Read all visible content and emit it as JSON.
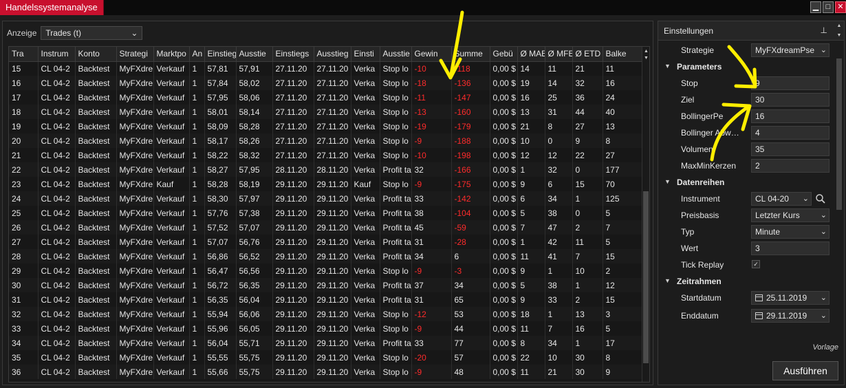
{
  "window": {
    "title": "Handelssystemanalyse"
  },
  "toolbar": {
    "label": "Anzeige",
    "view_selected": "Trades (t)"
  },
  "grid": {
    "columns": [
      "Tra",
      "Instrum",
      "Konto",
      "Strategi",
      "Marktpo",
      "An",
      "Einstieg",
      "Ausstie",
      "Einstiegs",
      "Ausstieg",
      "Einsti",
      "Ausstie",
      "Gewin",
      "Summe",
      "Gebü",
      "Ø MAE",
      "Ø MFE",
      "Ø ETD",
      "Balke"
    ],
    "rows": [
      [
        "15",
        "CL 04-2",
        "Backtest",
        "MyFXdre",
        "Verkauf",
        "1",
        "57,81",
        "57,91",
        "27.11.20",
        "27.11.20",
        "Verka",
        "Stop lo",
        "-10",
        "-118",
        "0,00 $",
        "14",
        "11",
        "21",
        "11"
      ],
      [
        "16",
        "CL 04-2",
        "Backtest",
        "MyFXdre",
        "Verkauf",
        "1",
        "57,84",
        "58,02",
        "27.11.20",
        "27.11.20",
        "Verka",
        "Stop lo",
        "-18",
        "-136",
        "0,00 $",
        "19",
        "14",
        "32",
        "16"
      ],
      [
        "17",
        "CL 04-2",
        "Backtest",
        "MyFXdre",
        "Verkauf",
        "1",
        "57,95",
        "58,06",
        "27.11.20",
        "27.11.20",
        "Verka",
        "Stop lo",
        "-11",
        "-147",
        "0,00 $",
        "16",
        "25",
        "36",
        "24"
      ],
      [
        "18",
        "CL 04-2",
        "Backtest",
        "MyFXdre",
        "Verkauf",
        "1",
        "58,01",
        "58,14",
        "27.11.20",
        "27.11.20",
        "Verka",
        "Stop lo",
        "-13",
        "-160",
        "0,00 $",
        "13",
        "31",
        "44",
        "40"
      ],
      [
        "19",
        "CL 04-2",
        "Backtest",
        "MyFXdre",
        "Verkauf",
        "1",
        "58,09",
        "58,28",
        "27.11.20",
        "27.11.20",
        "Verka",
        "Stop lo",
        "-19",
        "-179",
        "0,00 $",
        "21",
        "8",
        "27",
        "13"
      ],
      [
        "20",
        "CL 04-2",
        "Backtest",
        "MyFXdre",
        "Verkauf",
        "1",
        "58,17",
        "58,26",
        "27.11.20",
        "27.11.20",
        "Verka",
        "Stop lo",
        "-9",
        "-188",
        "0,00 $",
        "10",
        "0",
        "9",
        "8"
      ],
      [
        "21",
        "CL 04-2",
        "Backtest",
        "MyFXdre",
        "Verkauf",
        "1",
        "58,22",
        "58,32",
        "27.11.20",
        "27.11.20",
        "Verka",
        "Stop lo",
        "-10",
        "-198",
        "0,00 $",
        "12",
        "12",
        "22",
        "27"
      ],
      [
        "22",
        "CL 04-2",
        "Backtest",
        "MyFXdre",
        "Verkauf",
        "1",
        "58,27",
        "57,95",
        "28.11.20",
        "28.11.20",
        "Verka",
        "Profit ta",
        "32",
        "-166",
        "0,00 $",
        "1",
        "32",
        "0",
        "177"
      ],
      [
        "23",
        "CL 04-2",
        "Backtest",
        "MyFXdre",
        "Kauf",
        "1",
        "58,28",
        "58,19",
        "29.11.20",
        "29.11.20",
        "Kauf",
        "Stop lo",
        "-9",
        "-175",
        "0,00 $",
        "9",
        "6",
        "15",
        "70"
      ],
      [
        "24",
        "CL 04-2",
        "Backtest",
        "MyFXdre",
        "Verkauf",
        "1",
        "58,30",
        "57,97",
        "29.11.20",
        "29.11.20",
        "Verka",
        "Profit ta",
        "33",
        "-142",
        "0,00 $",
        "6",
        "34",
        "1",
        "125"
      ],
      [
        "25",
        "CL 04-2",
        "Backtest",
        "MyFXdre",
        "Verkauf",
        "1",
        "57,76",
        "57,38",
        "29.11.20",
        "29.11.20",
        "Verka",
        "Profit ta",
        "38",
        "-104",
        "0,00 $",
        "5",
        "38",
        "0",
        "5"
      ],
      [
        "26",
        "CL 04-2",
        "Backtest",
        "MyFXdre",
        "Verkauf",
        "1",
        "57,52",
        "57,07",
        "29.11.20",
        "29.11.20",
        "Verka",
        "Profit ta",
        "45",
        "-59",
        "0,00 $",
        "7",
        "47",
        "2",
        "7"
      ],
      [
        "27",
        "CL 04-2",
        "Backtest",
        "MyFXdre",
        "Verkauf",
        "1",
        "57,07",
        "56,76",
        "29.11.20",
        "29.11.20",
        "Verka",
        "Profit ta",
        "31",
        "-28",
        "0,00 $",
        "1",
        "42",
        "11",
        "5"
      ],
      [
        "28",
        "CL 04-2",
        "Backtest",
        "MyFXdre",
        "Verkauf",
        "1",
        "56,86",
        "56,52",
        "29.11.20",
        "29.11.20",
        "Verka",
        "Profit ta",
        "34",
        "6",
        "0,00 $",
        "11",
        "41",
        "7",
        "15"
      ],
      [
        "29",
        "CL 04-2",
        "Backtest",
        "MyFXdre",
        "Verkauf",
        "1",
        "56,47",
        "56,56",
        "29.11.20",
        "29.11.20",
        "Verka",
        "Stop lo",
        "-9",
        "-3",
        "0,00 $",
        "9",
        "1",
        "10",
        "2"
      ],
      [
        "30",
        "CL 04-2",
        "Backtest",
        "MyFXdre",
        "Verkauf",
        "1",
        "56,72",
        "56,35",
        "29.11.20",
        "29.11.20",
        "Verka",
        "Profit ta",
        "37",
        "34",
        "0,00 $",
        "5",
        "38",
        "1",
        "12"
      ],
      [
        "31",
        "CL 04-2",
        "Backtest",
        "MyFXdre",
        "Verkauf",
        "1",
        "56,35",
        "56,04",
        "29.11.20",
        "29.11.20",
        "Verka",
        "Profit ta",
        "31",
        "65",
        "0,00 $",
        "9",
        "33",
        "2",
        "15"
      ],
      [
        "32",
        "CL 04-2",
        "Backtest",
        "MyFXdre",
        "Verkauf",
        "1",
        "55,94",
        "56,06",
        "29.11.20",
        "29.11.20",
        "Verka",
        "Stop lo",
        "-12",
        "53",
        "0,00 $",
        "18",
        "1",
        "13",
        "3"
      ],
      [
        "33",
        "CL 04-2",
        "Backtest",
        "MyFXdre",
        "Verkauf",
        "1",
        "55,96",
        "56,05",
        "29.11.20",
        "29.11.20",
        "Verka",
        "Stop lo",
        "-9",
        "44",
        "0,00 $",
        "11",
        "7",
        "16",
        "5"
      ],
      [
        "34",
        "CL 04-2",
        "Backtest",
        "MyFXdre",
        "Verkauf",
        "1",
        "56,04",
        "55,71",
        "29.11.20",
        "29.11.20",
        "Verka",
        "Profit ta",
        "33",
        "77",
        "0,00 $",
        "8",
        "34",
        "1",
        "17"
      ],
      [
        "35",
        "CL 04-2",
        "Backtest",
        "MyFXdre",
        "Verkauf",
        "1",
        "55,55",
        "55,75",
        "29.11.20",
        "29.11.20",
        "Verka",
        "Stop lo",
        "-20",
        "57",
        "0,00 $",
        "22",
        "10",
        "30",
        "8"
      ],
      [
        "36",
        "CL 04-2",
        "Backtest",
        "MyFXdre",
        "Verkauf",
        "1",
        "55,66",
        "55,75",
        "29.11.20",
        "29.11.20",
        "Verka",
        "Stop lo",
        "-9",
        "48",
        "0,00 $",
        "11",
        "21",
        "30",
        "9"
      ]
    ]
  },
  "settings": {
    "title": "Einstellungen",
    "strategy_label": "Strategie",
    "strategy_value": "MyFXdreamPse",
    "categories": {
      "parameters": "Parameters",
      "data_series": "Datenreihen",
      "time_frame": "Zeitrahmen"
    },
    "parameters": [
      {
        "label": "Stop",
        "value": "9"
      },
      {
        "label": "Ziel",
        "value": "30"
      },
      {
        "label": "BollingerPe",
        "value": "16"
      },
      {
        "label": "Bollinger Abw…",
        "value": "4"
      },
      {
        "label": "Volumen",
        "value": "35"
      },
      {
        "label": "MaxMinKerzen",
        "value": "2"
      }
    ],
    "instrument_label": "Instrument",
    "instrument_value": "CL 04-20",
    "price_basis_label": "Preisbasis",
    "price_basis_value": "Letzter Kurs",
    "type_label": "Typ",
    "type_value": "Minute",
    "value_label": "Wert",
    "value_value": "3",
    "tick_replay_label": "Tick Replay",
    "tick_replay_checked": "✓",
    "start_label": "Startdatum",
    "start_value": "25.11.2019",
    "end_label": "Enddatum",
    "end_value": "29.11.2019",
    "template_label": "Vorlage",
    "run_label": "Ausführen"
  },
  "colors": {
    "accent": "#c8102e",
    "negative": "#ff2b2b",
    "annotation": "#ffee00"
  }
}
